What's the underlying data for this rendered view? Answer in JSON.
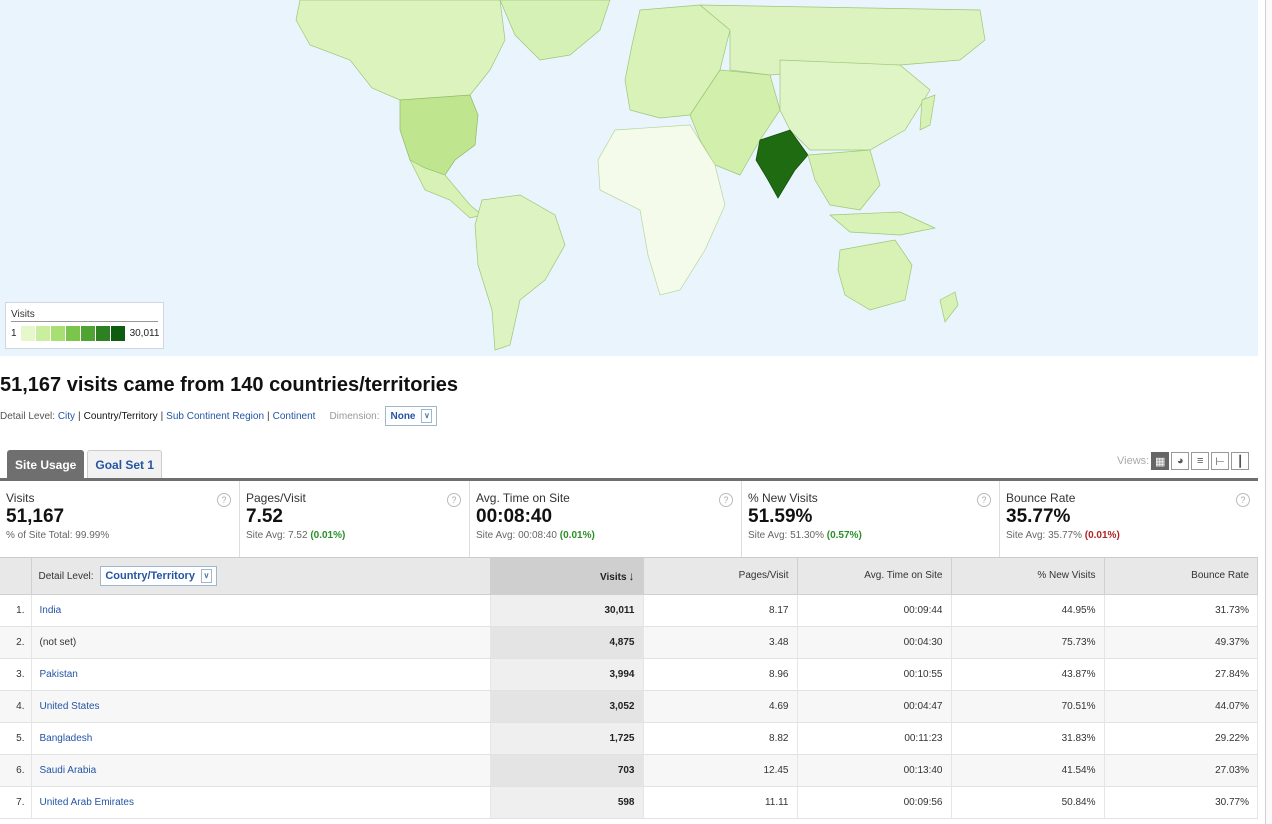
{
  "legend": {
    "title": "Visits",
    "min": "1",
    "max": "30,011",
    "scale_colors": [
      "#e6f7c9",
      "#c9ee9d",
      "#a8df72",
      "#7cc54d",
      "#4fa332",
      "#2d8122",
      "#0f5c10"
    ]
  },
  "map_colors": {
    "ocean": "#e9f4fc",
    "land_light": "#e8f7d0",
    "land_mid": "#d4f0b0",
    "us": "#bfe68f",
    "india": "#1f6b12",
    "africa": "#f5fbea"
  },
  "headline": "51,167 visits came from 140 countries/territories",
  "detail_level": {
    "label": "Detail Level:",
    "options": [
      "City",
      "Country/Territory",
      "Sub Continent Region",
      "Continent"
    ],
    "dimension_label": "Dimension:",
    "dimension_value": "None"
  },
  "tabs": [
    {
      "label": "Site Usage"
    },
    {
      "label": "Goal Set 1"
    }
  ],
  "views_label": "Views:",
  "metrics": [
    {
      "name": "Visits",
      "value": "51,167",
      "sub": "% of Site Total: 99.99%",
      "delta": ""
    },
    {
      "name": "Pages/Visit",
      "value": "7.52",
      "sub": "Site Avg: 7.52",
      "delta": "(0.01%)"
    },
    {
      "name": "Avg. Time on Site",
      "value": "00:08:40",
      "sub": "Site Avg: 00:08:40",
      "delta": "(0.01%)"
    },
    {
      "name": "% New Visits",
      "value": "51.59%",
      "sub": "Site Avg: 51.30%",
      "delta": "(0.57%)"
    },
    {
      "name": "Bounce Rate",
      "value": "35.77%",
      "sub": "Site Avg: 35.77%",
      "delta": "(0.01%)"
    }
  ],
  "table": {
    "detail_label": "Detail Level:",
    "detail_value": "Country/Territory",
    "columns": [
      "Visits",
      "Pages/Visit",
      "Avg. Time on Site",
      "% New Visits",
      "Bounce Rate"
    ],
    "rows": [
      {
        "idx": "1.",
        "name": "India",
        "link": true,
        "visits": "30,011",
        "ppv": "8.17",
        "time": "00:09:44",
        "newv": "44.95%",
        "bounce": "31.73%"
      },
      {
        "idx": "2.",
        "name": "(not set)",
        "link": false,
        "visits": "4,875",
        "ppv": "3.48",
        "time": "00:04:30",
        "newv": "75.73%",
        "bounce": "49.37%"
      },
      {
        "idx": "3.",
        "name": "Pakistan",
        "link": true,
        "visits": "3,994",
        "ppv": "8.96",
        "time": "00:10:55",
        "newv": "43.87%",
        "bounce": "27.84%"
      },
      {
        "idx": "4.",
        "name": "United States",
        "link": true,
        "visits": "3,052",
        "ppv": "4.69",
        "time": "00:04:47",
        "newv": "70.51%",
        "bounce": "44.07%"
      },
      {
        "idx": "5.",
        "name": "Bangladesh",
        "link": true,
        "visits": "1,725",
        "ppv": "8.82",
        "time": "00:11:23",
        "newv": "31.83%",
        "bounce": "29.22%"
      },
      {
        "idx": "6.",
        "name": "Saudi Arabia",
        "link": true,
        "visits": "703",
        "ppv": "12.45",
        "time": "00:13:40",
        "newv": "41.54%",
        "bounce": "27.03%"
      },
      {
        "idx": "7.",
        "name": "United Arab Emirates",
        "link": true,
        "visits": "598",
        "ppv": "11.11",
        "time": "00:09:56",
        "newv": "50.84%",
        "bounce": "30.77%"
      }
    ]
  }
}
